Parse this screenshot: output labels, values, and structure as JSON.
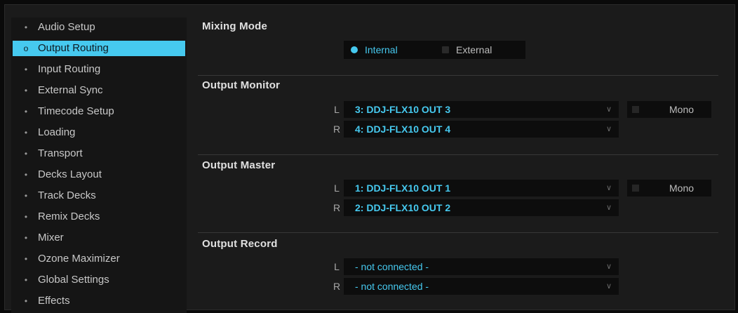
{
  "sidebar": {
    "items": [
      {
        "label": "Audio Setup",
        "active": false
      },
      {
        "label": "Output Routing",
        "active": true
      },
      {
        "label": "Input Routing",
        "active": false
      },
      {
        "label": "External Sync",
        "active": false
      },
      {
        "label": "Timecode Setup",
        "active": false
      },
      {
        "label": "Loading",
        "active": false
      },
      {
        "label": "Transport",
        "active": false
      },
      {
        "label": "Decks Layout",
        "active": false
      },
      {
        "label": "Track Decks",
        "active": false
      },
      {
        "label": "Remix Decks",
        "active": false
      },
      {
        "label": "Mixer",
        "active": false
      },
      {
        "label": "Ozone Maximizer",
        "active": false
      },
      {
        "label": "Global Settings",
        "active": false
      },
      {
        "label": "Effects",
        "active": false
      }
    ],
    "bullet_active": "o",
    "bullet_inactive": "•"
  },
  "mixing_mode": {
    "title": "Mixing Mode",
    "internal_label": "Internal",
    "external_label": "External",
    "selected": "Internal"
  },
  "output_monitor": {
    "title": "Output Monitor",
    "left_label": "L",
    "right_label": "R",
    "left_value": "3: DDJ-FLX10 OUT 3",
    "right_value": "4: DDJ-FLX10 OUT 4",
    "mono_label": "Mono",
    "mono_checked": false
  },
  "output_master": {
    "title": "Output Master",
    "left_label": "L",
    "right_label": "R",
    "left_value": "1: DDJ-FLX10 OUT 1",
    "right_value": "2: DDJ-FLX10 OUT 2",
    "mono_label": "Mono",
    "mono_checked": false
  },
  "output_record": {
    "title": "Output Record",
    "left_label": "L",
    "right_label": "R",
    "left_value": "- not connected -",
    "right_value": "- not connected -"
  },
  "icons": {
    "chevron": "chevron-down-icon"
  },
  "colors": {
    "accent": "#46c9ef",
    "background": "#1b1b1b",
    "sidebar": "#151515",
    "field": "#0d0d0d"
  }
}
